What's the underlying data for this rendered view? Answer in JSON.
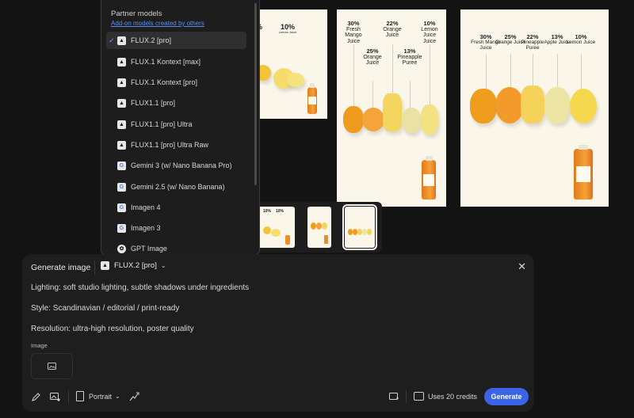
{
  "colors": {
    "background": "#131313",
    "panel": "#1e1e1e",
    "accent": "#3b63e8",
    "link": "#5a8fe6",
    "poster_bg": "#fbf6ea"
  },
  "dropdown": {
    "heading": "Partner models",
    "subheading": "Add-on models created by others",
    "items": [
      {
        "label": "FLUX.2 [pro]",
        "icon": "flux-logo-icon",
        "selected": true
      },
      {
        "label": "FLUX.1 Kontext [max]",
        "icon": "flux-logo-icon"
      },
      {
        "label": "FLUX.1 Kontext [pro]",
        "icon": "flux-logo-icon"
      },
      {
        "label": "FLUX1.1 [pro]",
        "icon": "flux-logo-icon"
      },
      {
        "label": "FLUX1.1 [pro] Ultra",
        "icon": "flux-logo-icon"
      },
      {
        "label": "FLUX1.1 [pro] Ultra Raw",
        "icon": "flux-logo-icon"
      },
      {
        "label": "Gemini 3 (w/ Nano Banana Pro)",
        "icon": "google-logo-icon"
      },
      {
        "label": "Gemini 2.5 (w/ Nano Banana)",
        "icon": "google-logo-icon"
      },
      {
        "label": "Imagen 4",
        "icon": "google-logo-icon"
      },
      {
        "label": "Imagen 3",
        "icon": "google-logo-icon"
      },
      {
        "label": "GPT Image",
        "icon": "openai-logo-icon"
      }
    ]
  },
  "posters": {
    "p1": {
      "labels": [
        {
          "pct": "%",
          "name": ""
        },
        {
          "pct": "10%",
          "name": "Lemon Juice"
        }
      ]
    },
    "p2": {
      "labels": [
        {
          "pct": "30%",
          "name": "Fresh Mango Juice"
        },
        {
          "pct": "25%",
          "name": "Orange Juice"
        },
        {
          "pct": "22%",
          "name": "Orange Juice"
        },
        {
          "pct": "13%",
          "name": "Pineapple Puree"
        },
        {
          "pct": "10%",
          "name": "Lemon Juice Juice"
        }
      ]
    },
    "p3": {
      "labels": [
        {
          "pct": "30%",
          "name": "Fresh Mango Juice"
        },
        {
          "pct": "25%",
          "name": "Orange Juice"
        },
        {
          "pct": "22%",
          "name": "Pineapple Puree"
        },
        {
          "pct": "13%",
          "name": "Apple Juice"
        },
        {
          "pct": "10%",
          "name": "Lemon Juice"
        }
      ]
    }
  },
  "thumbnails": {
    "t1": {
      "pct_a": "10%",
      "pct_b": "10%"
    }
  },
  "panel": {
    "title": "Generate image",
    "model_label": "FLUX.2 [pro]",
    "prompt_lines": [
      "Lighting: soft studio lighting, subtle shadows under ingredients",
      "Style: Scandinavian / editorial / print-ready",
      "Resolution: ultra-high resolution, poster quality"
    ],
    "image_label": "Image",
    "orientation": "Portrait",
    "credits": "Uses 20 credits",
    "generate_label": "Generate"
  }
}
